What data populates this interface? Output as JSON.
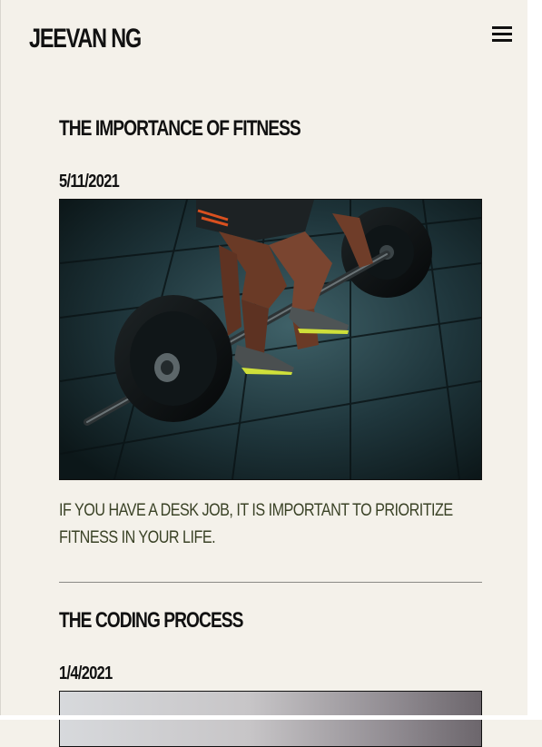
{
  "site": {
    "brand": "JEEVAN NG",
    "menu_icon": "hamburger-menu-icon"
  },
  "posts": [
    {
      "title": "THE IMPORTANCE OF FITNESS",
      "date": "5/11/2021",
      "image": "barbell-deadlift-photo",
      "excerpt": "IF YOU HAVE A DESK JOB, IT IS IMPORTANT TO PRIORITIZE FITNESS IN YOUR LIFE."
    },
    {
      "title": "THE CODING PROCESS",
      "date": "1/4/2021",
      "image": "coding-gradient-photo"
    }
  ],
  "colors": {
    "background": "#f4f1ea",
    "text": "#111111",
    "excerpt": "#3a4226"
  }
}
